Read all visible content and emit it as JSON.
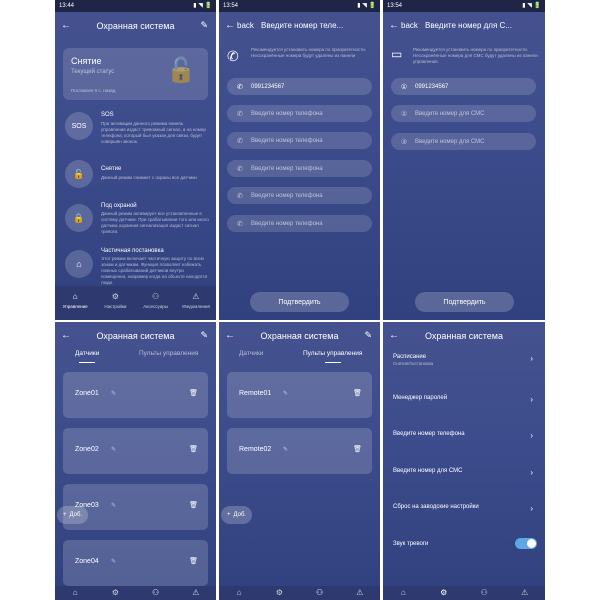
{
  "status": {
    "time_a": "13:44",
    "time_b": "13:54",
    "time_c": "13:54",
    "time_d": "",
    "icons": "▮ ◥ 🔋"
  },
  "p1": {
    "title": "Охранная система",
    "status_title": "Снятие",
    "status_sub": "Текущий статус",
    "status_foot": "Поставлен 0 с. назад",
    "items": [
      {
        "title": "SOS",
        "desc": "При активации данного режима панель управления издаст тревожный сигнал, а на номер телефона, который был указан для связи, будет совершён звонок.",
        "icon": "SOS"
      },
      {
        "title": "Снятие",
        "desc": "Данный режим снимает с охраны все датчики",
        "icon": "🔓"
      },
      {
        "title": "Под охраной",
        "desc": "Данный режим активирует все установленные в систему датчики. При срабатывании того или иного датчика охранная сигнализация издаст сигнал тревоги.",
        "icon": "🔒"
      },
      {
        "title": "Частичная постановка",
        "desc": "Этот режим включает частичную защиту по всем зонам и датчикам. Функция позволяет избежать ложных срабатываний датчиков внутри помещения, например когда на объекте находятся люди.",
        "icon": "⌂"
      }
    ],
    "tabs": [
      {
        "label": "Управление",
        "icon": "⌂"
      },
      {
        "label": "Настройки",
        "icon": "⚙"
      },
      {
        "label": "Аксессуары",
        "icon": "⚇"
      },
      {
        "label": "Уведомления",
        "icon": "⚠"
      }
    ]
  },
  "p2": {
    "back": "back",
    "title": "Введите номер теле...",
    "hint": "Рекомендуется установить номера по приоритетности. Несохранённые номера будут удалены из панели управления",
    "first_value": "0991234567",
    "placeholder": "Введите номер телефона",
    "confirm": "Подтвердить"
  },
  "p3": {
    "back": "back",
    "title": "Введите номер для С...",
    "hint": "Рекомендуется установить номера по приоритетности. Несохранённые номера для СМС будут удалены из панели управления.",
    "first_value": "0991234567",
    "placeholder": "Введите номер для СМС",
    "confirm": "Подтвердить"
  },
  "p4": {
    "title": "Охранная система",
    "tab_active": "Датчики",
    "tab_other": "Пульты управления",
    "zones": [
      "Zone01",
      "Zone02",
      "Zone03",
      "Zone04"
    ],
    "add": "Доб."
  },
  "p5": {
    "title": "Охранная система",
    "tab_other": "Датчики",
    "tab_active": "Пульты управления",
    "remotes": [
      "Remote01",
      "Remote02"
    ],
    "add": "Доб."
  },
  "p6": {
    "title": "Охранная система",
    "rows": [
      {
        "label": "Расписание",
        "sub": "Снятие/постановка"
      },
      {
        "label": "Менеджер паролей",
        "sub": ""
      },
      {
        "label": "Введите номер телефона",
        "sub": ""
      },
      {
        "label": "Введите номер для СМС",
        "sub": ""
      },
      {
        "label": "Сброс на заводские настройки",
        "sub": ""
      },
      {
        "label": "Звук тревоги",
        "sub": ""
      }
    ],
    "alarm_sound": true
  },
  "colors": {
    "accent": "#5fa8e8",
    "bg_top": "#45528f",
    "bg_bottom": "#31417f"
  }
}
